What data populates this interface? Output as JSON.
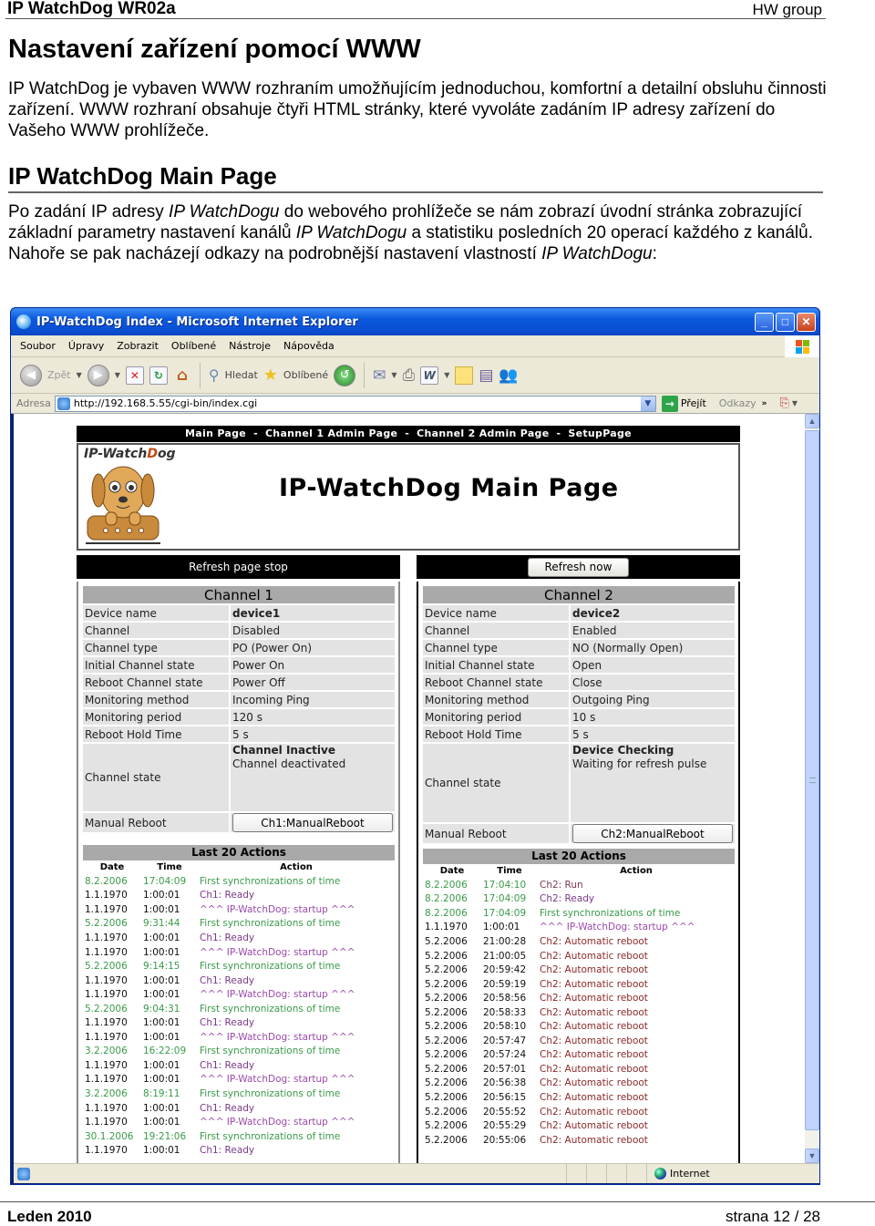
{
  "doc": {
    "header_left": "IP WatchDog WR02a",
    "header_right": "HW group",
    "title": "Nastavení zařízení pomocí WWW",
    "intro": "IP WatchDog je vybaven WWW rozhraním umožňujícím jednoduchou, komfortní a detailní obsluhu činnosti zařízení. WWW rozhraní obsahuje čtyři HTML stránky, které vyvoláte zadáním IP adresy zařízení do Vašeho WWW prohlížeče.",
    "section_title": "IP WatchDog Main Page",
    "section_para": {
      "part1": "Po zadání IP adresy ",
      "em1": "IP WatchDogu",
      "part2": " do webového prohlížeče se nám zobrazí úvodní stránka zobrazující základní parametry nastavení kanálů ",
      "em2": "IP WatchDogu",
      "part3": " a statistiku posledních 20 operací každého z kanálů. Nahoře se pak nacházejí odkazy na podrobnější nastavení vlastností ",
      "em3": "IP WatchDogu",
      "part4": ":"
    },
    "footer_left": "Leden 2010",
    "footer_right": "strana 12 / 28"
  },
  "browser": {
    "title": "IP-WatchDog Index - Microsoft Internet Explorer",
    "menu": [
      "Soubor",
      "Úpravy",
      "Zobrazit",
      "Oblíbené",
      "Nástroje",
      "Nápověda"
    ],
    "toolbar": {
      "back": "Zpět",
      "search": "Hledat",
      "favorites": "Oblíbené"
    },
    "address_label": "Adresa",
    "address_value": "http://192.168.5.55/cgi-bin/index.cgi",
    "go_label": "Přejít",
    "links_label": "Odkazy",
    "status_zone": "Internet"
  },
  "webpage": {
    "nav": [
      "Main Page",
      "Channel 1 Admin Page",
      "Channel 2 Admin Page",
      "SetupPage"
    ],
    "nav_sep": "-",
    "logo_text_a": "IP-Watch",
    "logo_text_b": "D",
    "logo_text_c": "og",
    "heading": "IP-WatchDog Main Page",
    "refresh_stop": "Refresh page stop",
    "refresh_now": "Refresh now",
    "channels": [
      {
        "title": "Channel 1",
        "rows": [
          {
            "k": "Device name",
            "v": "device1"
          },
          {
            "k": "Channel",
            "v": "Disabled"
          },
          {
            "k": "Channel type",
            "v": "PO (Power On)"
          },
          {
            "k": "Initial Channel state",
            "v": "Power On"
          },
          {
            "k": "Reboot Channel state",
            "v": "Power Off"
          },
          {
            "k": "Monitoring method",
            "v": "Incoming Ping"
          },
          {
            "k": "Monitoring period",
            "v": "120 s"
          },
          {
            "k": "Reboot Hold Time",
            "v": "5 s"
          }
        ],
        "state_label": "Channel state",
        "state_title": "Channel Inactive",
        "state_desc": "Channel deactivated",
        "manual_label": "Manual Reboot",
        "manual_button": "Ch1:ManualReboot",
        "log_title": "Last 20 Actions",
        "log_headers": [
          "Date",
          "Time",
          "Action"
        ],
        "log": [
          {
            "date": "8.2.2006",
            "time": "17:04:09",
            "action": "First synchronizations of time",
            "type": "sync"
          },
          {
            "date": "1.1.1970",
            "time": "1:00:01",
            "action": "Ch1: Ready",
            "type": "ready"
          },
          {
            "date": "1.1.1970",
            "time": "1:00:01",
            "action": "^^^ IP-WatchDog: startup ^^^",
            "type": "startup"
          },
          {
            "date": "5.2.2006",
            "time": "9:31:44",
            "action": "First synchronizations of time",
            "type": "sync"
          },
          {
            "date": "1.1.1970",
            "time": "1:00:01",
            "action": "Ch1: Ready",
            "type": "ready"
          },
          {
            "date": "1.1.1970",
            "time": "1:00:01",
            "action": "^^^ IP-WatchDog: startup ^^^",
            "type": "startup"
          },
          {
            "date": "5.2.2006",
            "time": "9:14:15",
            "action": "First synchronizations of time",
            "type": "sync"
          },
          {
            "date": "1.1.1970",
            "time": "1:00:01",
            "action": "Ch1: Ready",
            "type": "ready"
          },
          {
            "date": "1.1.1970",
            "time": "1:00:01",
            "action": "^^^ IP-WatchDog: startup ^^^",
            "type": "startup"
          },
          {
            "date": "5.2.2006",
            "time": "9:04:31",
            "action": "First synchronizations of time",
            "type": "sync"
          },
          {
            "date": "1.1.1970",
            "time": "1:00:01",
            "action": "Ch1: Ready",
            "type": "ready"
          },
          {
            "date": "1.1.1970",
            "time": "1:00:01",
            "action": "^^^ IP-WatchDog: startup ^^^",
            "type": "startup"
          },
          {
            "date": "3.2.2006",
            "time": "16:22:09",
            "action": "First synchronizations of time",
            "type": "sync"
          },
          {
            "date": "1.1.1970",
            "time": "1:00:01",
            "action": "Ch1: Ready",
            "type": "ready"
          },
          {
            "date": "1.1.1970",
            "time": "1:00:01",
            "action": "^^^ IP-WatchDog: startup ^^^",
            "type": "startup"
          },
          {
            "date": "3.2.2006",
            "time": "8:19:11",
            "action": "First synchronizations of time",
            "type": "sync"
          },
          {
            "date": "1.1.1970",
            "time": "1:00:01",
            "action": "Ch1: Ready",
            "type": "ready"
          },
          {
            "date": "1.1.1970",
            "time": "1:00:01",
            "action": "^^^ IP-WatchDog: startup ^^^",
            "type": "startup"
          },
          {
            "date": "30.1.2006",
            "time": "19:21:06",
            "action": "First synchronizations of time",
            "type": "sync"
          },
          {
            "date": "1.1.1970",
            "time": "1:00:01",
            "action": "Ch1: Ready",
            "type": "ready"
          }
        ]
      },
      {
        "title": "Channel 2",
        "rows": [
          {
            "k": "Device name",
            "v": "device2"
          },
          {
            "k": "Channel",
            "v": "Enabled"
          },
          {
            "k": "Channel type",
            "v": "NO (Normally Open)"
          },
          {
            "k": "Initial Channel state",
            "v": "Open"
          },
          {
            "k": "Reboot Channel state",
            "v": "Close"
          },
          {
            "k": "Monitoring method",
            "v": "Outgoing Ping"
          },
          {
            "k": "Monitoring period",
            "v": "10 s"
          },
          {
            "k": "Reboot Hold Time",
            "v": "5 s"
          }
        ],
        "state_label": "Channel state",
        "state_title": "Device Checking",
        "state_desc": "Waiting for refresh pulse",
        "manual_label": "Manual Reboot",
        "manual_button": "Ch2:ManualReboot",
        "log_title": "Last 20 Actions",
        "log_headers": [
          "Date",
          "Time",
          "Action"
        ],
        "log": [
          {
            "date": "8.2.2006",
            "time": "17:04:10",
            "action": "Ch2: Run",
            "type": "run",
            "dt": "sync"
          },
          {
            "date": "8.2.2006",
            "time": "17:04:09",
            "action": "Ch2: Ready",
            "type": "ready",
            "dt": "sync"
          },
          {
            "date": "8.2.2006",
            "time": "17:04:09",
            "action": "First synchronizations of time",
            "type": "sync",
            "dt": "sync"
          },
          {
            "date": "1.1.1970",
            "time": "1:00:01",
            "action": "^^^ IP-WatchDog: startup ^^^",
            "type": "startup"
          },
          {
            "date": "5.2.2006",
            "time": "21:00:28",
            "action": "Ch2: Automatic reboot",
            "type": "reboot"
          },
          {
            "date": "5.2.2006",
            "time": "21:00:05",
            "action": "Ch2: Automatic reboot",
            "type": "reboot"
          },
          {
            "date": "5.2.2006",
            "time": "20:59:42",
            "action": "Ch2: Automatic reboot",
            "type": "reboot"
          },
          {
            "date": "5.2.2006",
            "time": "20:59:19",
            "action": "Ch2: Automatic reboot",
            "type": "reboot"
          },
          {
            "date": "5.2.2006",
            "time": "20:58:56",
            "action": "Ch2: Automatic reboot",
            "type": "reboot"
          },
          {
            "date": "5.2.2006",
            "time": "20:58:33",
            "action": "Ch2: Automatic reboot",
            "type": "reboot"
          },
          {
            "date": "5.2.2006",
            "time": "20:58:10",
            "action": "Ch2: Automatic reboot",
            "type": "reboot"
          },
          {
            "date": "5.2.2006",
            "time": "20:57:47",
            "action": "Ch2: Automatic reboot",
            "type": "reboot"
          },
          {
            "date": "5.2.2006",
            "time": "20:57:24",
            "action": "Ch2: Automatic reboot",
            "type": "reboot"
          },
          {
            "date": "5.2.2006",
            "time": "20:57:01",
            "action": "Ch2: Automatic reboot",
            "type": "reboot"
          },
          {
            "date": "5.2.2006",
            "time": "20:56:38",
            "action": "Ch2: Automatic reboot",
            "type": "reboot"
          },
          {
            "date": "5.2.2006",
            "time": "20:56:15",
            "action": "Ch2: Automatic reboot",
            "type": "reboot"
          },
          {
            "date": "5.2.2006",
            "time": "20:55:52",
            "action": "Ch2: Automatic reboot",
            "type": "reboot"
          },
          {
            "date": "5.2.2006",
            "time": "20:55:29",
            "action": "Ch2: Automatic reboot",
            "type": "reboot"
          },
          {
            "date": "5.2.2006",
            "time": "20:55:06",
            "action": "Ch2: Automatic reboot",
            "type": "reboot"
          }
        ]
      }
    ]
  },
  "colors": {
    "xp_title_blue": "#0b58de",
    "xp_chrome": "#ece9d8",
    "log_sync": "#3a9a4a",
    "log_ready": "#7a3a8a",
    "log_reboot": "#8a2a2a",
    "table_header": "#a9a9a9",
    "table_cell": "#e3e3e3"
  }
}
